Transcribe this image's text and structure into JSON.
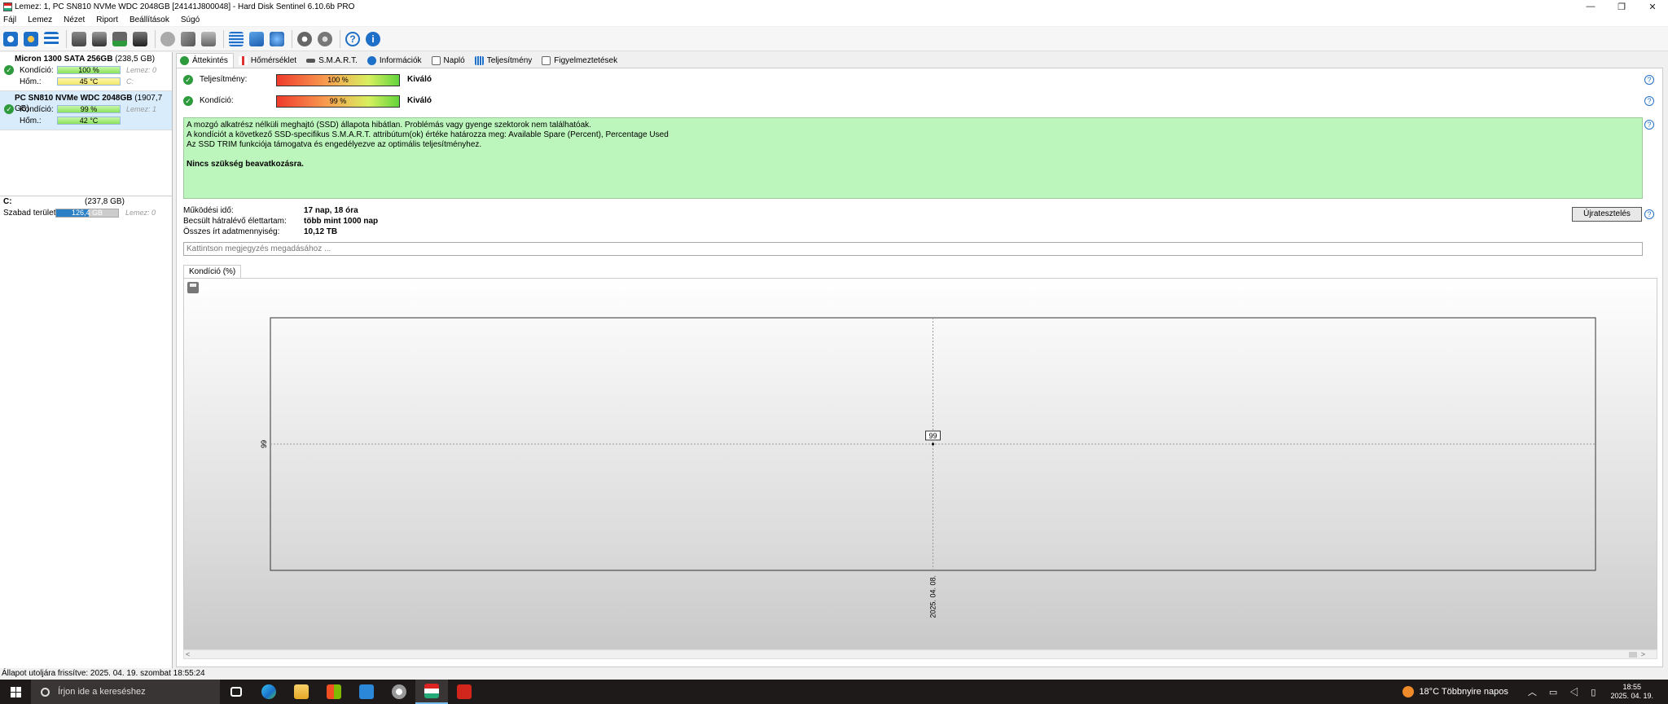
{
  "window": {
    "title": "Lemez: 1, PC SN810 NVMe WDC 2048GB [24141J800048]  -  Hard Disk Sentinel 6.10.6b PRO",
    "controls": [
      "—",
      "❐",
      "✕"
    ]
  },
  "menu": [
    "Fájl",
    "Lemez",
    "Nézet",
    "Riport",
    "Beállítások",
    "Súgó"
  ],
  "toolbar": {
    "icons": [
      "refresh-icon",
      "refresh-all-icon",
      "disk-list-icon",
      "disk-icon",
      "disk-test-icon",
      "disk-check-icon",
      "disk-erase-icon",
      "disk-gray-icon",
      "tools-icon",
      "disk-settings-icon",
      "report-icon",
      "mail-icon",
      "network-icon",
      "settings-icon",
      "settings-alt-icon",
      "help-icon",
      "info-icon"
    ]
  },
  "disks": [
    {
      "name": "Micron 1300 SATA 256GB",
      "size": "(238,5 GB)",
      "health_label": "Kondíció:",
      "health": "100 %",
      "health_extra": "Lemez: 0",
      "temp_label": "Hőm.:",
      "temp": "45 °C",
      "temp_extra": "C:"
    },
    {
      "name": "PC SN810 NVMe WDC 2048GB",
      "size": "(1907,7 GB)",
      "health_label": "Kondíció:",
      "health": "99 %",
      "health_extra": "Lemez: 1",
      "temp_label": "Hőm.:",
      "temp": "42 °C",
      "temp_extra": ""
    }
  ],
  "volume": {
    "name": "C:",
    "size": "(237,8 GB)",
    "free_label": "Szabad terület",
    "free": "126,4 GB",
    "free_fraction": 0.53,
    "extra": "Lemez: 0"
  },
  "tabs": [
    "Áttekintés",
    "Hőmérséklet",
    "S.M.A.R.T.",
    "Információk",
    "Napló",
    "Teljesítmény",
    "Figyelmeztetések"
  ],
  "overview": {
    "perf_label": "Teljesítmény:",
    "perf_value": "100 %",
    "perf_word": "Kiváló",
    "health_label": "Kondíció:",
    "health_value": "99 %",
    "health_word": "Kiváló",
    "status_lines": [
      "A mozgó alkatrész nélküli meghajtó (SSD) állapota hibátlan. Problémás vagy gyenge szektorok nem találhatóak.",
      "A kondíciót a következő SSD-specifikus S.M.A.R.T. attribútum(ok) értéke határozza meg:  Available Spare (Percent), Percentage Used",
      "Az SSD TRIM funkciója támogatva és engedélyezve az optimális teljesítményhez."
    ],
    "status_bold": "Nincs szükség beavatkozásra.",
    "info": [
      {
        "key": "Működési idő:",
        "value": "17 nap, 18 óra"
      },
      {
        "key": "Becsült hátralévő élettartam:",
        "value": "több mint 1000 nap"
      },
      {
        "key": "Összes írt adatmennyiség:",
        "value": "10,12 TB"
      }
    ],
    "retest_label": "Újratesztelés",
    "note_placeholder": "Kattintson megjegyzés megadásához ..."
  },
  "chart_tab": "Kondíció  (%)",
  "chart_data": {
    "type": "line",
    "x": [
      "2025. 04. 08."
    ],
    "series": [
      {
        "values": [
          99
        ]
      }
    ],
    "xlabel": "",
    "ylabel": "",
    "yticks": [
      "99"
    ],
    "data_label": "99",
    "grid": true
  },
  "statusline": "Állapot utoljára frissítve: 2025. 04. 19. szombat 18:55:24",
  "taskbar": {
    "search_placeholder": "Írjon ide a kereséshez",
    "weather": "18°C  Többnyire napos",
    "time": "18:55",
    "date": "2025. 04. 19."
  }
}
